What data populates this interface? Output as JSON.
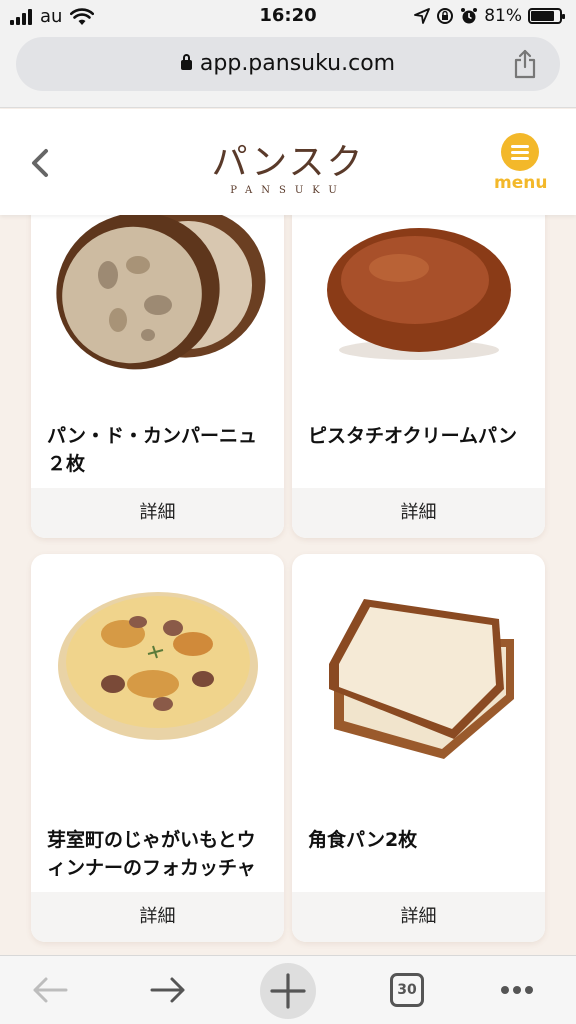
{
  "status_bar": {
    "carrier": "au",
    "time": "16:20",
    "battery": "81%"
  },
  "browser": {
    "url": "app.pansuku.com",
    "tab_count": "30"
  },
  "site": {
    "logo_jp": "パンスク",
    "logo_en": "PANSUKU",
    "menu_label": "menu"
  },
  "products": [
    {
      "name_line1": "パン・ド・カンパーニュ",
      "name_line2": "２枚",
      "detail": "詳細"
    },
    {
      "name_line1": "ピスタチオクリームパン",
      "name_line2": "",
      "detail": "詳細"
    },
    {
      "name_line1": "芽室町のじゃがいもとウ",
      "name_line2": "ィンナーのフォカッチャ",
      "detail": "詳細"
    },
    {
      "name_line1": "角食パン2枚",
      "name_line2": "",
      "detail": "詳細"
    }
  ],
  "colors": {
    "accent": "#f3b82a",
    "logo": "#5a3a2a",
    "page_bg": "#f7f0ea"
  }
}
